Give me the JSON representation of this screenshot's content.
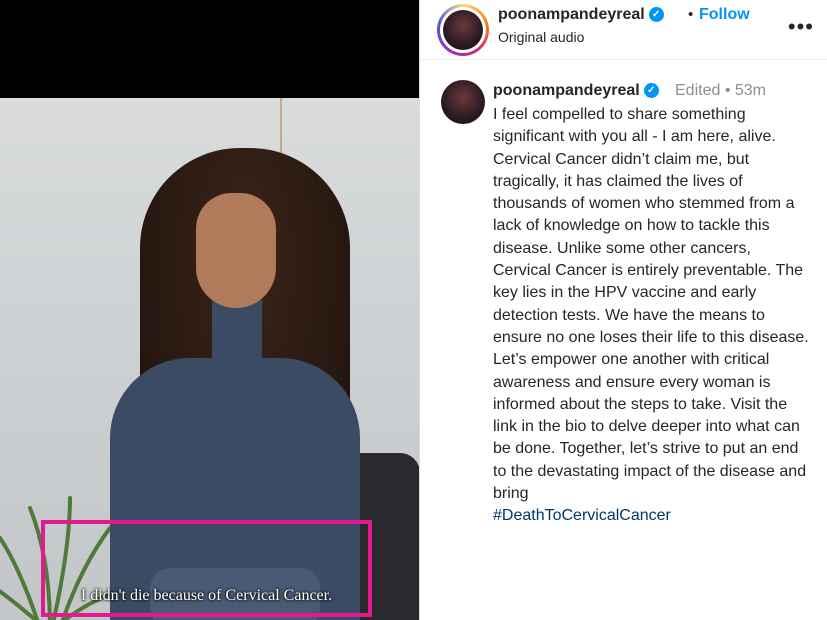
{
  "video": {
    "subtitle": "I didn't die because of Cervical Cancer."
  },
  "header": {
    "username": "poonampandeyreal",
    "follow_label": "Follow",
    "audio_label": "Original audio",
    "more_label": "•••"
  },
  "caption": {
    "username": "poonampandeyreal",
    "edited": "Edited",
    "time": "53m",
    "text": "I feel compelled to share something significant with you all - I am here, alive. Cervical Cancer didn’t claim me, but tragically, it has claimed the lives of thousands of women who stemmed from a lack of knowledge on how to tackle this disease. Unlike some other cancers, Cervical Cancer is entirely preventable. The key lies in the HPV vaccine and early detection tests. We have the means to ensure no one loses their life to this disease. Let’s empower one another with critical awareness and ensure every woman is informed about the steps to take. Visit the link in the bio to delve deeper into what can be done. Together, let’s strive to put an end to the devastating impact of the disease and bring",
    "hashtag": "#DeathToCervicalCancer"
  },
  "colors": {
    "highlight_box": "#e31a8f",
    "follow": "#0095f6",
    "hashtag": "#00376b"
  }
}
